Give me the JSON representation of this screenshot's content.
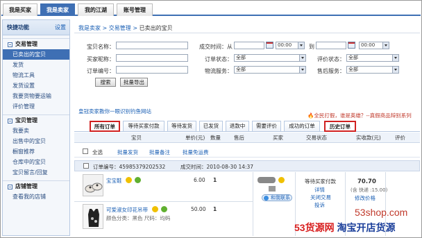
{
  "top_tabs": [
    {
      "label": "我是买家",
      "active": false
    },
    {
      "label": "我是卖家",
      "active": true
    },
    {
      "label": "我的江湖",
      "active": false
    },
    {
      "label": "账号管理",
      "active": false
    }
  ],
  "sidebar": {
    "quick_title": "快捷功能",
    "quick_settings": "设置",
    "sections": [
      {
        "title": "交易管理",
        "items": [
          "已卖出的宝贝",
          "发货",
          "物流工具",
          "发货设置",
          "我要货物要运输",
          "评价管理"
        ],
        "active_index": 0
      },
      {
        "title": "宝贝管理",
        "items": [
          "我要卖",
          "出售中的宝贝",
          "橱窗推荐",
          "仓库中的宝贝",
          "宝贝留言/回复"
        ]
      },
      {
        "title": "店铺管理",
        "items": [
          "查看我的店铺"
        ]
      }
    ]
  },
  "breadcrumb": {
    "a": "我是卖家",
    "b": "交易管理",
    "current": "已卖出的宝贝",
    "sep": " > "
  },
  "form": {
    "item_name_label": "宝贝名称：",
    "deal_time_label": "成交时间：从",
    "to_label": "到",
    "time_from": "00:00",
    "time_to": "00:00",
    "buyer_label": "买家昵称：",
    "order_status_label": "订单状态：",
    "order_status_value": "全部",
    "review_status_label": "评价状态：",
    "review_status_value": "全部",
    "order_no_label": "订单编号：",
    "logistics_label": "物流服务：",
    "logistics_value": "全部",
    "after_sale_label": "售后服务：",
    "after_sale_value": "全部",
    "search_btn": "搜索",
    "export_btn": "批量导出"
  },
  "ad_left": "皇冠卖家教你一眼识别钓鱼网站",
  "ad_right": "全民打假，谁是英雄？--真假商品辩别系列",
  "order_tabs": [
    {
      "label": "所有订单",
      "highlight": true
    },
    {
      "label": "等待买家付款",
      "highlight": false
    },
    {
      "label": "等待发货",
      "highlight": false
    },
    {
      "label": "已发货",
      "highlight": false
    },
    {
      "label": "退款中",
      "highlight": false
    },
    {
      "label": "需要评价",
      "highlight": false
    },
    {
      "label": "成功的订单",
      "highlight": false
    },
    {
      "label": "历史订单",
      "highlight": true
    }
  ],
  "table_headers": {
    "item": "宝贝",
    "unit_price": "单价(元)",
    "qty": "数量",
    "after_sale": "售后",
    "buyer": "买家",
    "trade_status": "交易状态",
    "paid": "实收款(元)",
    "review": "评价"
  },
  "bulk": {
    "select_all": "全选",
    "bulk_ship": "批量发货",
    "bulk_note": "批量备注",
    "bulk_free": "批量免运费"
  },
  "order": {
    "order_no": "订单编号：45985379202532",
    "deal_time": "成交时间：2010-08-30 14:37",
    "items": [
      {
        "name": "宝宝鞋",
        "price": "6.00",
        "qty": "1"
      },
      {
        "name": "可爱淑女印花吊带",
        "spec": "颜色分类：黑色    尺码：均码",
        "price": "50.00",
        "qty": "1"
      }
    ],
    "contact": "和我联系",
    "status": "等待买家付款",
    "status_links": [
      "详情",
      "关闭交易",
      "投诉"
    ],
    "total": "70.70",
    "shipping": "(含 快递 :15.00)",
    "modify_price": "修改价格"
  },
  "watermark": {
    "url": "53shop.com",
    "brand_a": "53货源网",
    "brand_b": "淘宝开店货源"
  },
  "colors": {
    "accent": "#3e6fb4",
    "highlight_border": "#d02020",
    "link": "#1a5fb4"
  }
}
